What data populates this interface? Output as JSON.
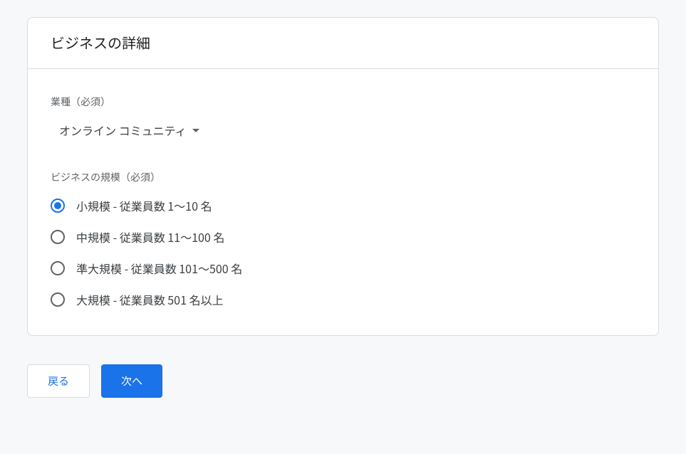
{
  "card": {
    "title": "ビジネスの詳細"
  },
  "industry": {
    "label": "業種（必須）",
    "selected": "オンライン コミュニティ"
  },
  "size": {
    "label": "ビジネスの規模（必須）",
    "options": [
      {
        "label": "小規模 - 従業員数 1～10 名",
        "selected": true
      },
      {
        "label": "中規模 - 従業員数 11～100 名",
        "selected": false
      },
      {
        "label": "準大規模 - 従業員数 101～500 名",
        "selected": false
      },
      {
        "label": "大規模 - 従業員数 501 名以上",
        "selected": false
      }
    ]
  },
  "actions": {
    "back": "戻る",
    "next": "次へ"
  }
}
